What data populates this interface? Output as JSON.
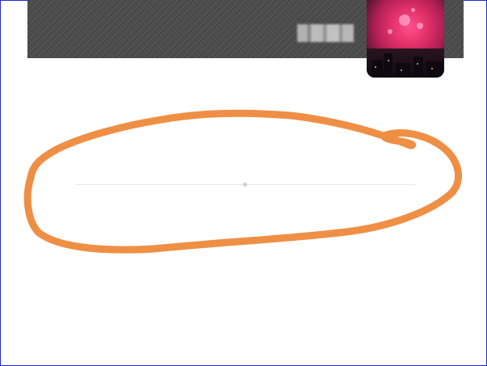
{
  "page": {
    "border_color": "#1f2bd1",
    "background": "#ffffff"
  },
  "header": {
    "banner_color": "#4a4a4a",
    "name_obscured": true
  },
  "avatar": {
    "icon": "fireworks-photo-avatar"
  },
  "annotation": {
    "color": "#ef8f45",
    "shape": "hand-drawn-ellipse"
  }
}
